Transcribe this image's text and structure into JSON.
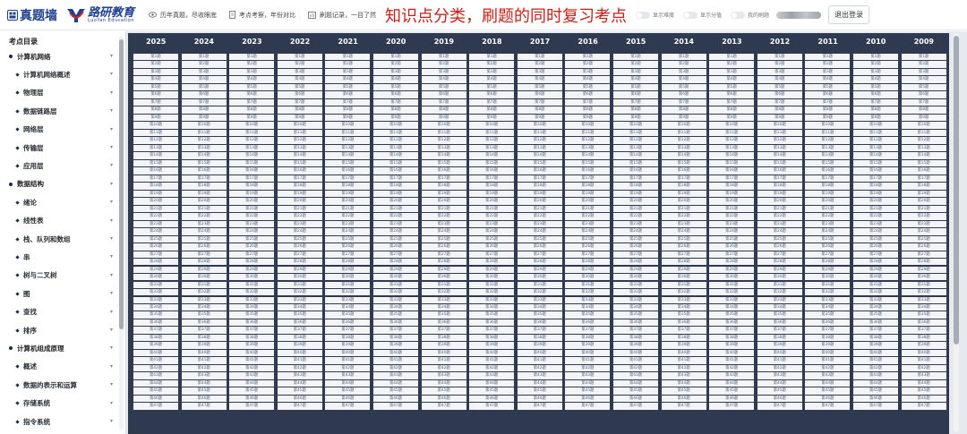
{
  "header": {
    "brand_title": "真题墙",
    "logo_cn": "路研教育",
    "logo_en": "LuoYan Education",
    "features": [
      "历年真题，尽收眼底",
      "考点考察，年份对比",
      "刷题记录，一目了然"
    ],
    "headline": "知识点分类，刷题的同时复习考点",
    "toggles": [
      "显示难度",
      "显示分值",
      "我的刷题"
    ],
    "logout_label": "退出登录",
    "colors": {
      "brand": "#1c3f94",
      "headline": "#c91f16",
      "grid_bg": "#2f3a51"
    }
  },
  "sidebar": {
    "title": "考点目录",
    "items": [
      {
        "label": "计算机网络",
        "level": "top"
      },
      {
        "label": "计算机网络概述",
        "level": "sub"
      },
      {
        "label": "物理层",
        "level": "sub"
      },
      {
        "label": "数据链路层",
        "level": "sub"
      },
      {
        "label": "网络层",
        "level": "sub"
      },
      {
        "label": "传输层",
        "level": "sub"
      },
      {
        "label": "应用层",
        "level": "sub"
      },
      {
        "label": "数据结构",
        "level": "top"
      },
      {
        "label": "绪论",
        "level": "sub"
      },
      {
        "label": "线性表",
        "level": "sub"
      },
      {
        "label": "栈、队列和数组",
        "level": "sub"
      },
      {
        "label": "串",
        "level": "sub"
      },
      {
        "label": "树与二叉树",
        "level": "sub"
      },
      {
        "label": "图",
        "level": "sub"
      },
      {
        "label": "查找",
        "level": "sub"
      },
      {
        "label": "排序",
        "level": "sub"
      },
      {
        "label": "计算机组成原理",
        "level": "top"
      },
      {
        "label": "概述",
        "level": "sub"
      },
      {
        "label": "数据的表示和运算",
        "level": "sub"
      },
      {
        "label": "存储系统",
        "level": "sub"
      },
      {
        "label": "指令系统",
        "level": "sub"
      }
    ]
  },
  "grid": {
    "years": [
      "2025",
      "2024",
      "2023",
      "2022",
      "2021",
      "2020",
      "2019",
      "2018",
      "2017",
      "2016",
      "2015",
      "2014",
      "2013",
      "2012",
      "2011",
      "2010",
      "2009"
    ],
    "question_count": 47,
    "question_prefix": "第",
    "question_suffix": "题"
  }
}
